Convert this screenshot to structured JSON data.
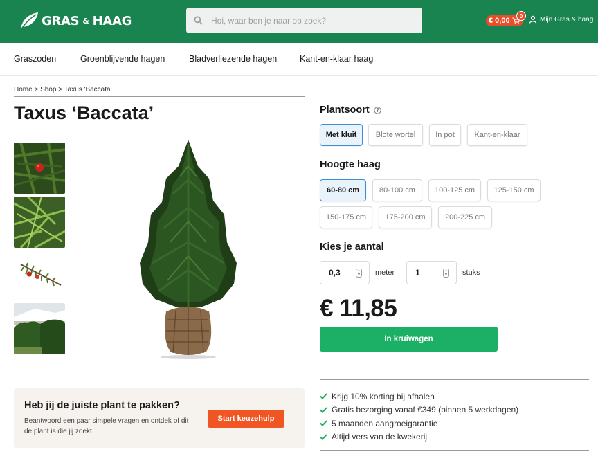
{
  "brand": {
    "name_left": "GRAS",
    "amp": "&",
    "name_right": "HAAG",
    "color": "#1a8450"
  },
  "search": {
    "placeholder": "Hoi, waar ben je naar op zoek?",
    "value": ""
  },
  "cart": {
    "total": "€ 0,00",
    "count": "0"
  },
  "account": {
    "label": "Mijn Gras & haag"
  },
  "nav": {
    "items": [
      "Graszoden",
      "Groenblijvende hagen",
      "Bladverliezende hagen",
      "Kant-en-klaar haag"
    ]
  },
  "breadcrumb": "Home > Shop > Taxus 'Baccata'",
  "product": {
    "title": "Taxus ‘Baccata’",
    "price": "€ 11,85"
  },
  "plantsoort": {
    "title": "Plantsoort",
    "options": [
      "Met kluit",
      "Blote wortel",
      "In pot",
      "Kant-en-klaar"
    ],
    "selected": "Met kluit"
  },
  "hoogte": {
    "title": "Hoogte haag",
    "options": [
      "60-80 cm",
      "80-100 cm",
      "100-125 cm",
      "125-150 cm",
      "150-175 cm",
      "175-200 cm",
      "200-225 cm"
    ],
    "selected": "60-80 cm"
  },
  "aantal": {
    "title": "Kies je aantal",
    "meter_value": "0,3",
    "meter_unit": "meter",
    "stuks_value": "1",
    "stuks_unit": "stuks"
  },
  "cart_button": "In kruiwagen",
  "usps": [
    "Krijg 10% korting bij afhalen",
    "Gratis bezorging vanaf €349 (binnen 5 werkdagen)",
    "5 maanden aangroeigarantie",
    "Altijd vers van de kwekerij"
  ],
  "help": {
    "title": "Heb jij de juiste plant te pakken?",
    "text": "Beantwoord een paar simpele vragen en ontdek of dit de plant is die jij zoekt.",
    "button": "Start keuzehulp"
  },
  "colors": {
    "accent_green": "#1bb065",
    "orange": "#f05524",
    "selected_blue": "#3b8fd6"
  }
}
